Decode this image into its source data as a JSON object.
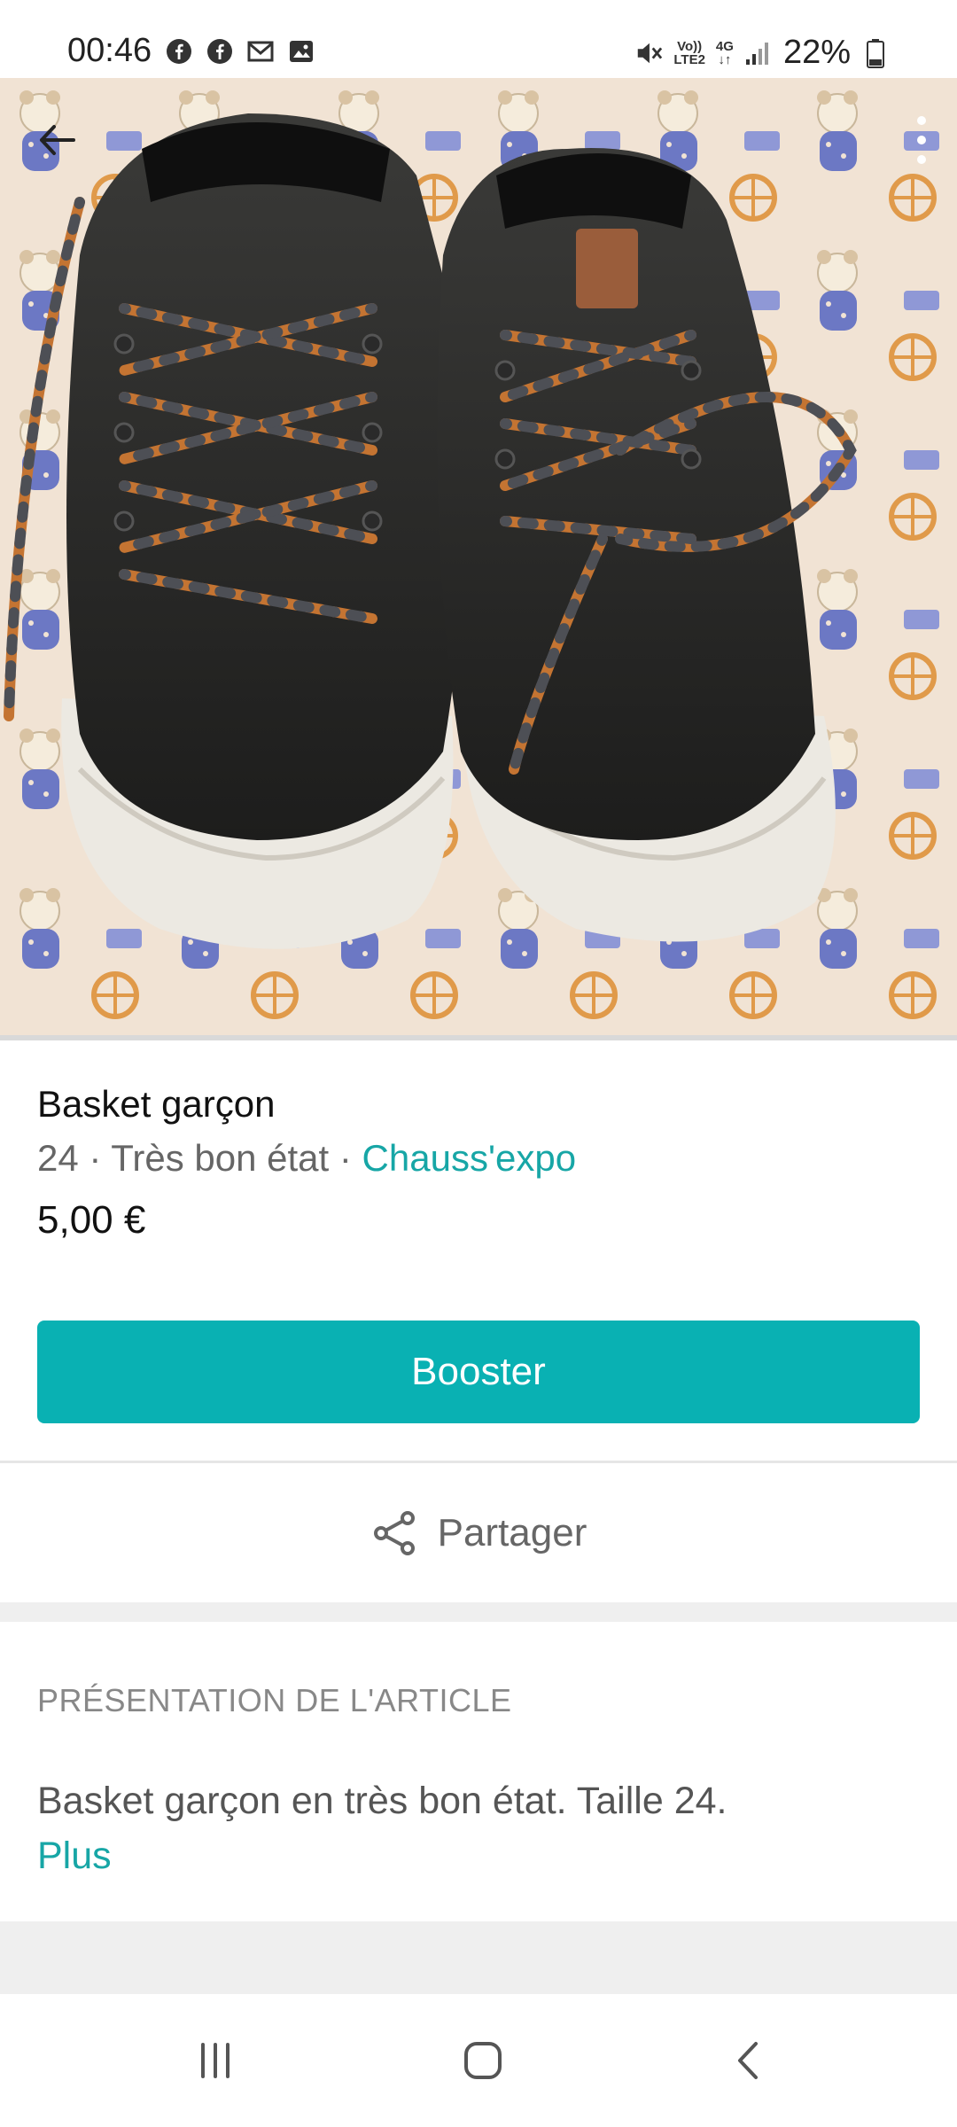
{
  "status_bar": {
    "time": "00:46",
    "battery": "22%",
    "volte": "Vo))\nLTE2",
    "network": "4G",
    "icons": [
      "facebook-icon",
      "facebook-icon",
      "gmail-icon",
      "gallery-icon",
      "mute-icon",
      "signal-icon",
      "battery-icon"
    ]
  },
  "item": {
    "title": "Basket garçon",
    "size": "24",
    "separator": " · ",
    "condition": "Très bon état",
    "brand": "Chauss'expo",
    "price": "5,00 €"
  },
  "actions": {
    "booster_label": "Booster",
    "share_label": "Partager"
  },
  "description": {
    "header": "PRÉSENTATION DE L'ARTICLE",
    "text": "Basket garçon en très bon état. Taille 24.",
    "more_label": "Plus"
  },
  "colors": {
    "accent": "#09b1b3",
    "link": "#17a6a6"
  }
}
